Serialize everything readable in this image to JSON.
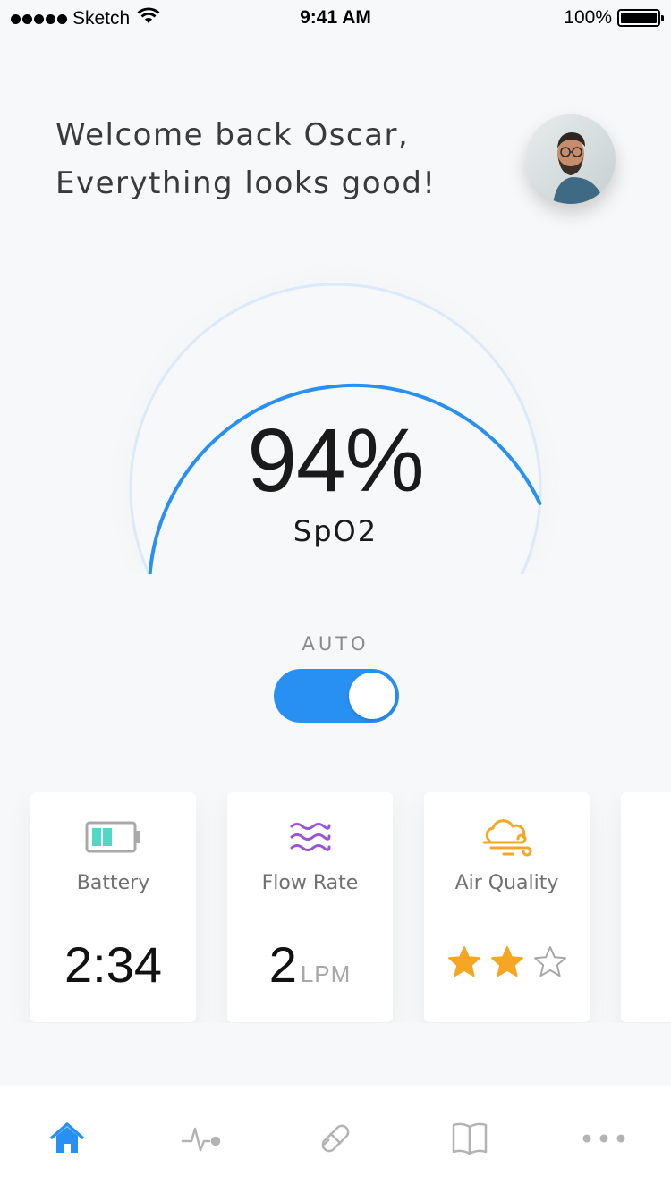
{
  "status_bar": {
    "carrier": "Sketch",
    "time": "9:41 AM",
    "battery": "100%"
  },
  "greeting": {
    "line1": "Welcome back Oscar,",
    "line2": "Everything looks good!"
  },
  "gauge": {
    "value": "94%",
    "label": "SpO2",
    "progress_fraction": 0.94,
    "color": "#2990F3"
  },
  "auto": {
    "label": "AUTO",
    "on": true
  },
  "cards": [
    {
      "icon": "battery-icon",
      "label": "Battery",
      "value": "2:34",
      "color": "#4FD8C4"
    },
    {
      "icon": "flow-waves-icon",
      "label": "Flow Rate",
      "value": "2",
      "unit": "LPM",
      "color": "#9A55D6"
    },
    {
      "icon": "cloud-wind-icon",
      "label": "Air Quality",
      "rating": 2,
      "rating_max": 3,
      "color": "#F5A623"
    }
  ],
  "tabs": [
    {
      "icon": "home-icon",
      "active": true
    },
    {
      "icon": "pulse-icon",
      "active": false
    },
    {
      "icon": "pill-icon",
      "active": false
    },
    {
      "icon": "book-icon",
      "active": false
    },
    {
      "icon": "more-icon",
      "active": false
    }
  ],
  "colors": {
    "accent": "#2990F3",
    "inactive_icon": "#B3B3B3",
    "star": "#F5A623"
  }
}
